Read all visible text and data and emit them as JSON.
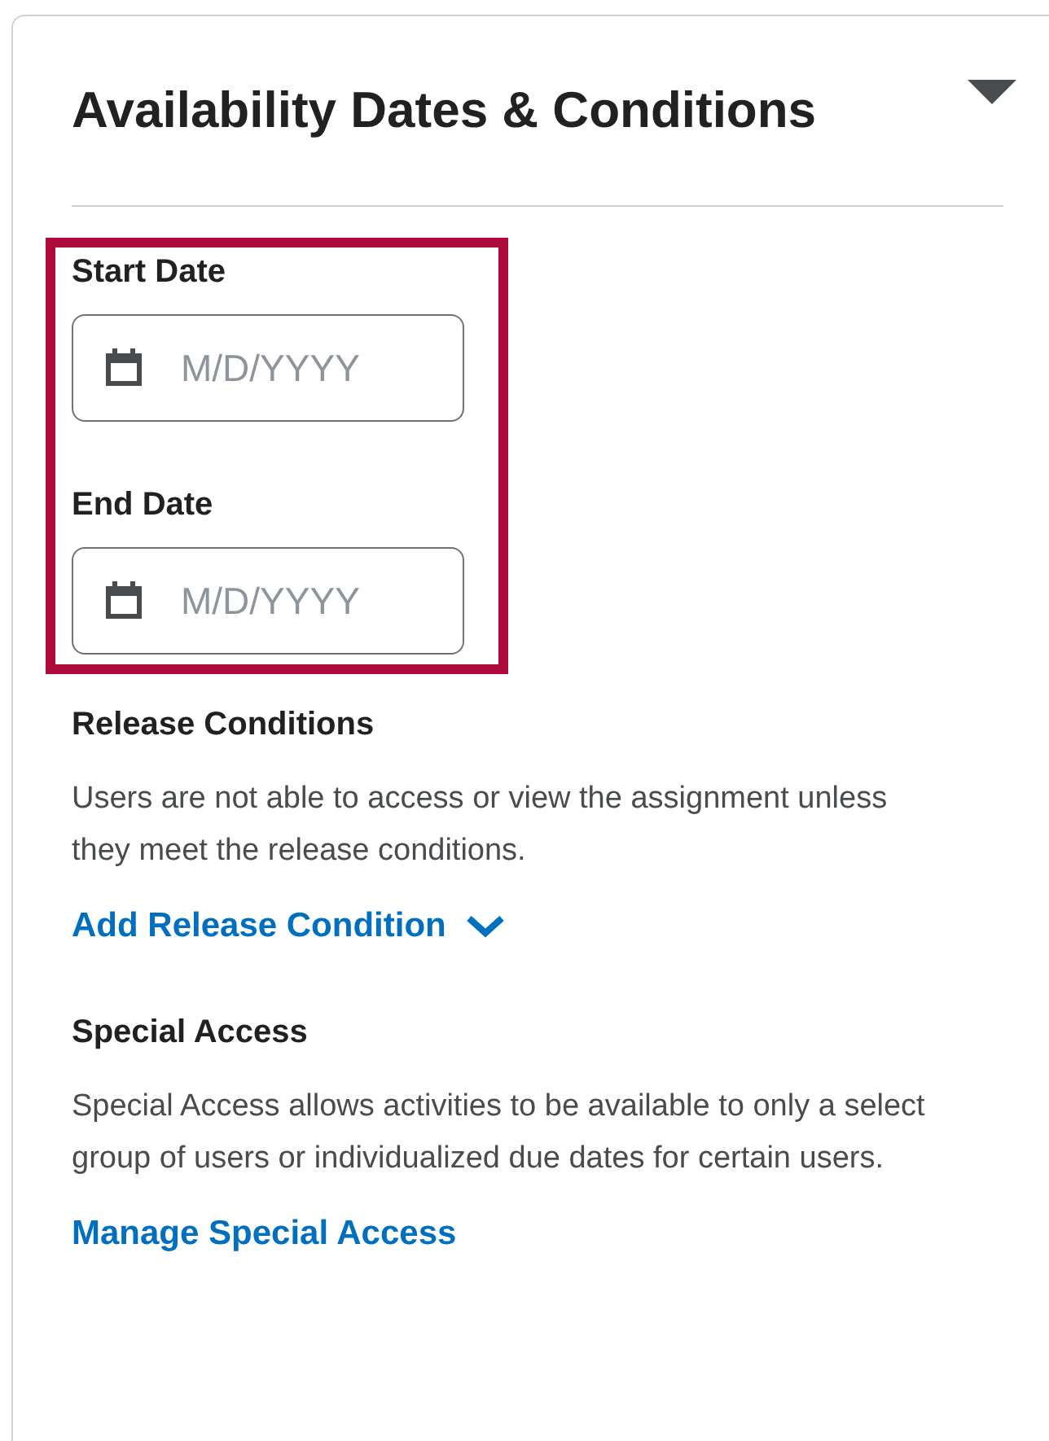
{
  "panel": {
    "title": "Availability Dates & Conditions",
    "expanded": true
  },
  "date_fields": [
    {
      "label": "Start Date",
      "placeholder": "M/D/YYYY"
    },
    {
      "label": "End Date",
      "placeholder": "M/D/YYYY"
    }
  ],
  "highlighted": true,
  "sections": [
    {
      "heading": "Release Conditions",
      "description": "Users are not able to access or view the assignment unless they meet the release conditions.",
      "link": "Add Release Condition",
      "link_has_menu": true
    },
    {
      "heading": "Special Access",
      "description": "Special Access allows activities to be available to only a select group of users or individualized due dates for certain users.",
      "link": "Manage Special Access",
      "link_has_menu": false
    }
  ]
}
